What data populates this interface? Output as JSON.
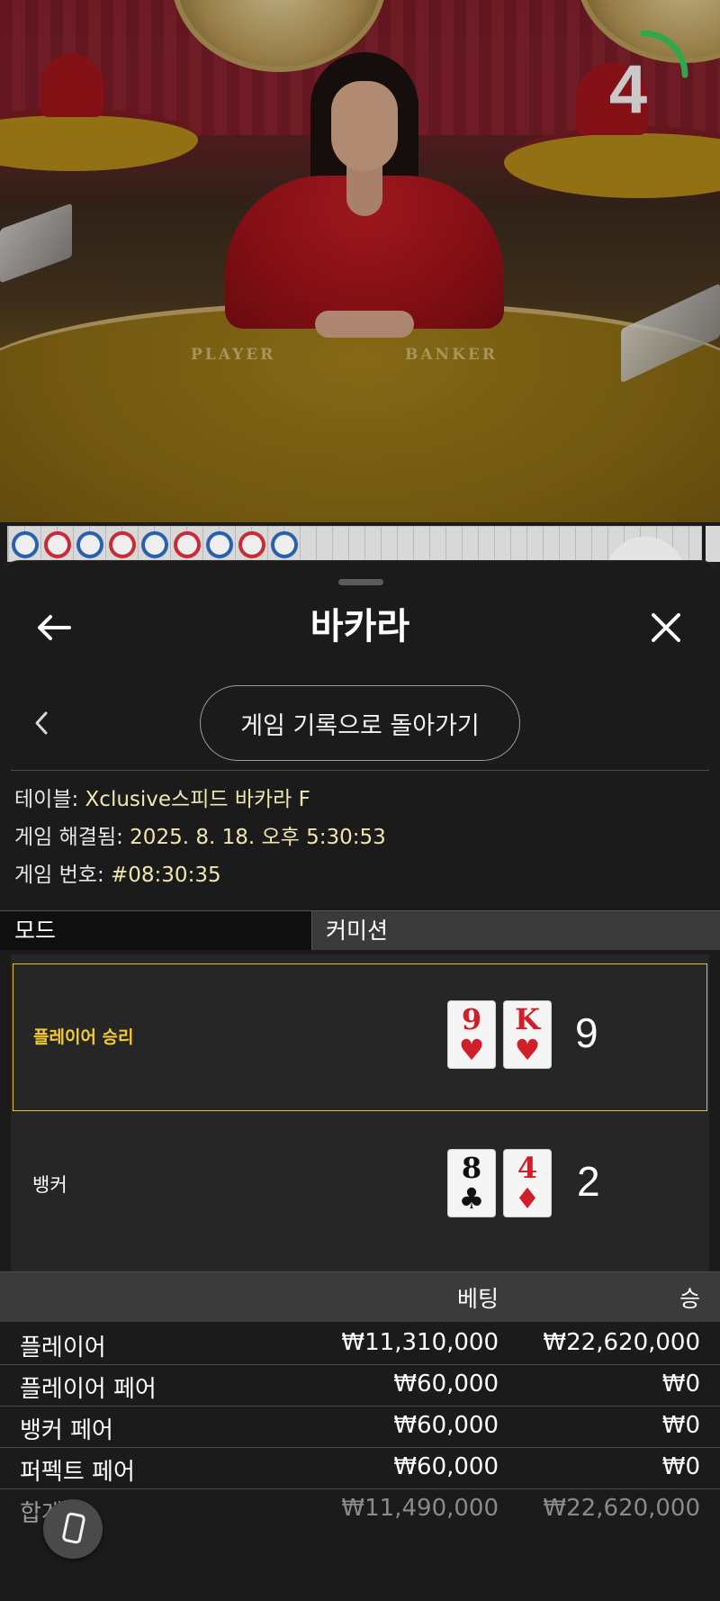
{
  "video": {
    "table_labels": [
      "PLAYER",
      "BANKER"
    ],
    "countdown": "4",
    "countdown_progress": 0.25
  },
  "roadmap": {
    "results": [
      "blue",
      "red",
      "blue",
      "red",
      "blue",
      "red",
      "blue",
      "red",
      "blue"
    ]
  },
  "header": {
    "title": "바카라",
    "back_icon": "arrow-left-icon",
    "close_icon": "close-icon"
  },
  "nav": {
    "prev_icon": "chevron-left-icon",
    "back_to_history": "게임 기록으로 돌아가기"
  },
  "details": {
    "table_label": "테이블: ",
    "table_value": "Xclusive스피드 바카라 F",
    "resolved_label": "게임 해결됨: ",
    "resolved_value": "2025. 8. 18. 오후 5:30:53",
    "round_label": "게임 번호: ",
    "round_value": "#08:30:35"
  },
  "tabs": {
    "mode": "모드",
    "commission": "커미션"
  },
  "result": {
    "player": {
      "label": "플레이어 승리",
      "cards": [
        {
          "rank": "9",
          "suit": "♥",
          "color": "red"
        },
        {
          "rank": "K",
          "suit": "♥",
          "color": "red"
        }
      ],
      "score": "9"
    },
    "banker": {
      "label": "뱅커",
      "cards": [
        {
          "rank": "8",
          "suit": "♣",
          "color": "black"
        },
        {
          "rank": "4",
          "suit": "♦",
          "color": "red"
        }
      ],
      "score": "2"
    }
  },
  "bets": {
    "col_bet": "베팅",
    "col_win": "승",
    "rows": [
      {
        "name": "플레이어",
        "bet": "₩11,310,000",
        "win": "₩22,620,000"
      },
      {
        "name": "플레이어 페어",
        "bet": "₩60,000",
        "win": "₩0"
      },
      {
        "name": "뱅커 페어",
        "bet": "₩60,000",
        "win": "₩0"
      },
      {
        "name": "퍼펙트 페어",
        "bet": "₩60,000",
        "win": "₩0"
      }
    ],
    "total": {
      "name": "합계",
      "bet": "₩11,490,000",
      "win": "₩22,620,000"
    }
  },
  "floating": {
    "icon": "phone-rotate-icon"
  },
  "colors": {
    "accent": "#e5c234",
    "player": "#2b5fb0",
    "banker": "#c92a35"
  }
}
